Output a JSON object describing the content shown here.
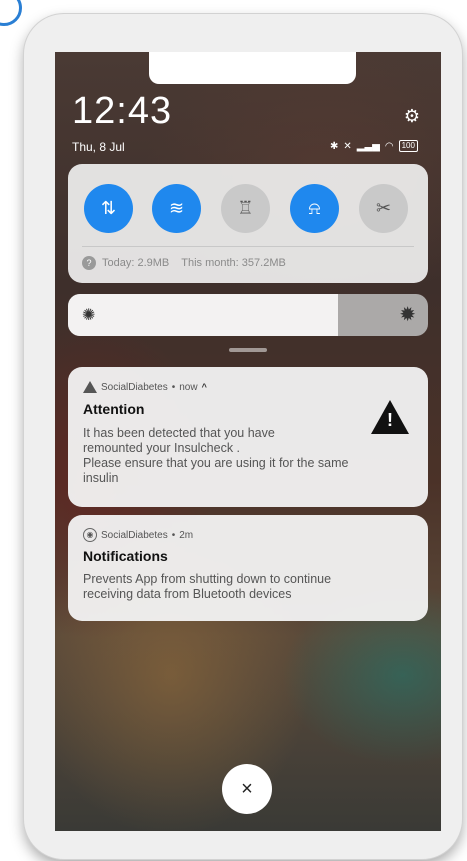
{
  "status_bar": {
    "time": "12:43",
    "date": "Thu, 8 Jul",
    "battery": "100"
  },
  "quick_settings": {
    "toggles": [
      {
        "name": "data",
        "icon": "mobile-data-icon",
        "on": true
      },
      {
        "name": "wifi",
        "icon": "wifi-icon",
        "on": true
      },
      {
        "name": "flashlight",
        "icon": "flashlight-icon",
        "on": false
      },
      {
        "name": "dnd",
        "icon": "silent-bell-icon",
        "on": true
      },
      {
        "name": "screenshot",
        "icon": "scissors-icon",
        "on": false
      }
    ],
    "data_today": "Today: 2.9MB",
    "data_month": "This month: 357.2MB",
    "accent_color": "#1f88ee"
  },
  "brightness": {
    "level": 0.75
  },
  "notifications": [
    {
      "app": "SocialDiabetes",
      "time": "now",
      "title": "Attention",
      "body_line1": "It has been detected that you have",
      "body_line2": "remounted your Insulcheck .",
      "body_line3": "Please ensure that you are using it for the same",
      "body_line4": "insulin"
    },
    {
      "app": "SocialDiabetes",
      "time": "2m",
      "title": "Notifications",
      "body_line1": "Prevents App from shutting down to continue",
      "body_line2": "receiving data from Bluetooth devices"
    }
  ],
  "close_button": "×"
}
